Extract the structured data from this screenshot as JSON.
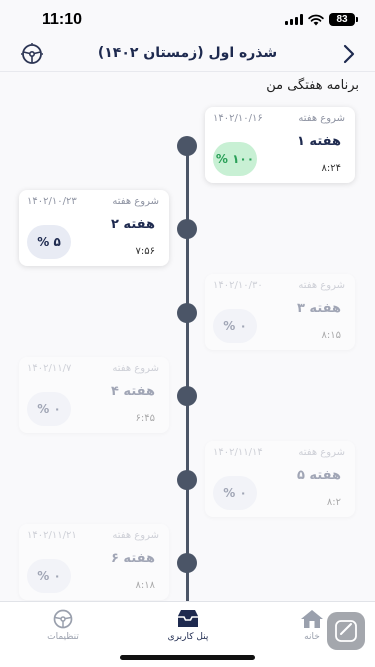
{
  "status_bar": {
    "time": "11:10",
    "battery": "83"
  },
  "header": {
    "title": "شذره اول (زمستان ۱۴۰۲)"
  },
  "section_title": "برنامه هفتگی من",
  "weeks": [
    {
      "start_label": "شروع هفته",
      "start_date": "۱۴۰۲/۱۰/۱۶",
      "title": "هفته ۱",
      "progress": "۱۰۰ %",
      "duration": "۸:۲۴"
    },
    {
      "start_label": "شروع هفته",
      "start_date": "۱۴۰۲/۱۰/۲۳",
      "title": "هفته ۲",
      "progress": "۵ %",
      "duration": "۷:۵۶"
    },
    {
      "start_label": "شروع هفته",
      "start_date": "۱۴۰۲/۱۰/۳۰",
      "title": "هفته ۳",
      "progress": "۰ %",
      "duration": "۸:۱۵"
    },
    {
      "start_label": "شروع هفته",
      "start_date": "۱۴۰۲/۱۱/۷",
      "title": "هفته ۴",
      "progress": "۰ %",
      "duration": "۶:۴۵"
    },
    {
      "start_label": "شروع هفته",
      "start_date": "۱۴۰۲/۱۱/۱۴",
      "title": "هفته ۵",
      "progress": "۰ %",
      "duration": "۸:۲"
    },
    {
      "start_label": "شروع هفته",
      "start_date": "۱۴۰۲/۱۱/۲۱",
      "title": "هفته ۶",
      "progress": "۰ %",
      "duration": "۸:۱۸"
    }
  ],
  "tabs": {
    "home": "خانه",
    "panel": "پنل کاربری",
    "settings": "تنظیمات"
  },
  "colors": {
    "primary": "#1e2a4f",
    "done_bg": "#c8f0d4",
    "done_text": "#2aa058",
    "timeline": "#4b5567"
  }
}
